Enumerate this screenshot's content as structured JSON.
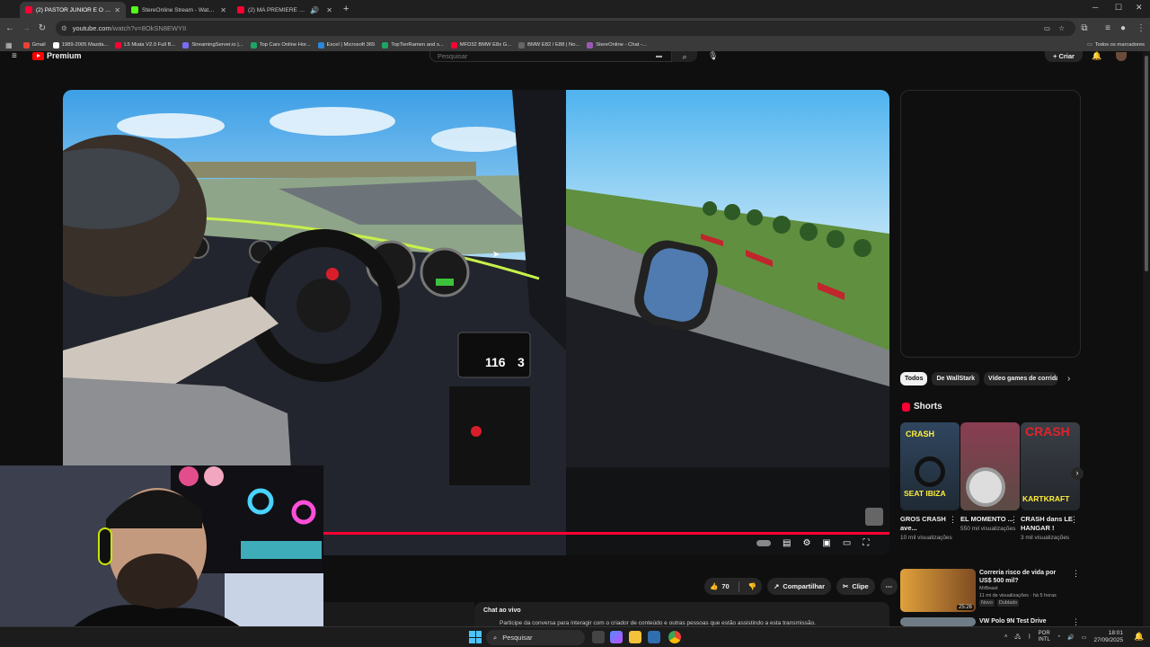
{
  "browser": {
    "tabs": [
      {
        "label": "(2) PASTOR JUNIOR E O SOM D",
        "active": true,
        "color": "#ff0033"
      },
      {
        "label": "StereOnline Stream - Watch Liv",
        "active": false,
        "color": "#53fc18"
      },
      {
        "label": "(2) MA PREMIERE COURSE",
        "active": false,
        "color": "#ff0033"
      }
    ],
    "new_tab": "+",
    "url_host": "youtube.com",
    "url_path": "/watch?v=8OkSN8EWYII",
    "bookmarks": [
      {
        "label": "Gmail",
        "color": "#ea4335"
      },
      {
        "label": "1989-2005 Mazda...",
        "color": "#ffffff"
      },
      {
        "label": "L5 Miata V2.0 Full B...",
        "color": "#ff0033"
      },
      {
        "label": "StreamingServer.io |...",
        "color": "#7b6cf6"
      },
      {
        "label": "Top Cars Online Hor...",
        "color": "#1fa463"
      },
      {
        "label": "Excel | Microsoft 365",
        "color": "#2b88d8"
      },
      {
        "label": "TopTierRamen and s...",
        "color": "#1fa463"
      },
      {
        "label": "MFD32 BMW E8x G...",
        "color": "#ff0033"
      },
      {
        "label": "BMW E82 / E88 | No...",
        "color": "#666666"
      },
      {
        "label": "StereOnline - Chat -...",
        "color": "#9b59b6"
      }
    ],
    "all_bookmarks": "Todos os marcadores"
  },
  "youtube": {
    "logo_text": "Premium",
    "search_placeholder": "Pesquisar",
    "create_label": "+ Criar",
    "chips": [
      "Todos",
      "De WallStark",
      "Vídeo games de corrida"
    ],
    "shorts_title": "Shorts",
    "shorts": [
      {
        "title": "GROS CRASH ave...",
        "views": "10 mil visualizações",
        "overlay_top": "CRASH",
        "overlay_bottom": "SEAT IBIZA"
      },
      {
        "title": "EL MOMENTO ...",
        "views": "550 mil visualizações",
        "overlay_top": "",
        "overlay_bottom": ""
      },
      {
        "title": "CRASH dans LE HANGAR !",
        "views": "3 mil visualizações",
        "overlay_top": "CRASH",
        "overlay_bottom": "KARTKRAFT"
      }
    ],
    "recommendations": [
      {
        "title": "Correria risco de vida por US$ 500 mil?",
        "channel": "MrBeast",
        "meta": "11 mi de visualizações · há 5 horas",
        "badges": [
          "Novo",
          "Dublado"
        ],
        "duration": "25:26"
      },
      {
        "title": "VW Polo 9N Test Drive",
        "channel": "",
        "meta": "",
        "badges": [],
        "duration": ""
      }
    ],
    "likes": "70",
    "share_label": "Compartilhar",
    "clip_label": "Clipe",
    "chat_title": "Chat ao vivo",
    "chat_desc": "Participe da conversa para interagir com o criador de conteúdo e outras pessoas que estão assistindo a esta transmissão.",
    "video_progress": 1.0,
    "dash_speed": "116",
    "dash_gear": "3"
  },
  "taskbar": {
    "search_label": "Pesquisar",
    "lang_top": "POR",
    "lang_bottom": "INTL",
    "time": "18:01",
    "date": "27/09/2025"
  }
}
